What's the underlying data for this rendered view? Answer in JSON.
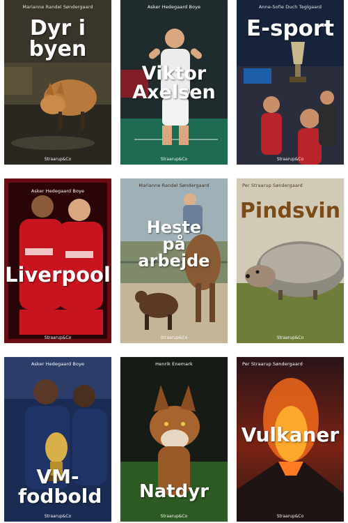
{
  "books": [
    {
      "author": "Marianne Randel Søndergaard",
      "title": "Dyr i byen",
      "publisher": "Straarup&Co",
      "icon": "fox-icon"
    },
    {
      "author": "Asker Hedegaard Boye",
      "title": "Viktor Axelsen",
      "publisher": "Straarup&Co",
      "icon": "badminton-player-icon"
    },
    {
      "author": "Anne-Sofie Duch Teglgaard",
      "title": "E-sport",
      "publisher": "Straarup&Co",
      "icon": "trophy-icon"
    },
    {
      "author": "Asker Hedegaard Boye",
      "title": "Liverpool",
      "publisher": "Straarup&Co",
      "icon": "football-players-icon"
    },
    {
      "author": "Marianne Randel Søndergaard",
      "title": "Heste på arbejde",
      "publisher": "Straarup&Co",
      "icon": "rodeo-icon"
    },
    {
      "author": "Per Straarup Søndergaard",
      "title": "Pindsvin",
      "publisher": "Straarup&Co",
      "icon": "hedgehog-icon"
    },
    {
      "author": "Asker Hedegaard Boye",
      "title": "VM-fodbold",
      "publisher": "Straarup&Co",
      "icon": "world-cup-trophy-icon"
    },
    {
      "author": "Henrik Enemark",
      "title": "Natdyr",
      "publisher": "Straarup&Co",
      "icon": "fox-icon"
    },
    {
      "author": "Per Straarup Søndergaard",
      "title": "Vulkaner",
      "publisher": "Straarup&Co",
      "icon": "volcano-icon"
    }
  ],
  "colors": {
    "page_bg": "#ffffff",
    "title_white": "#ffffff",
    "title_brown": "#7a4a17"
  }
}
